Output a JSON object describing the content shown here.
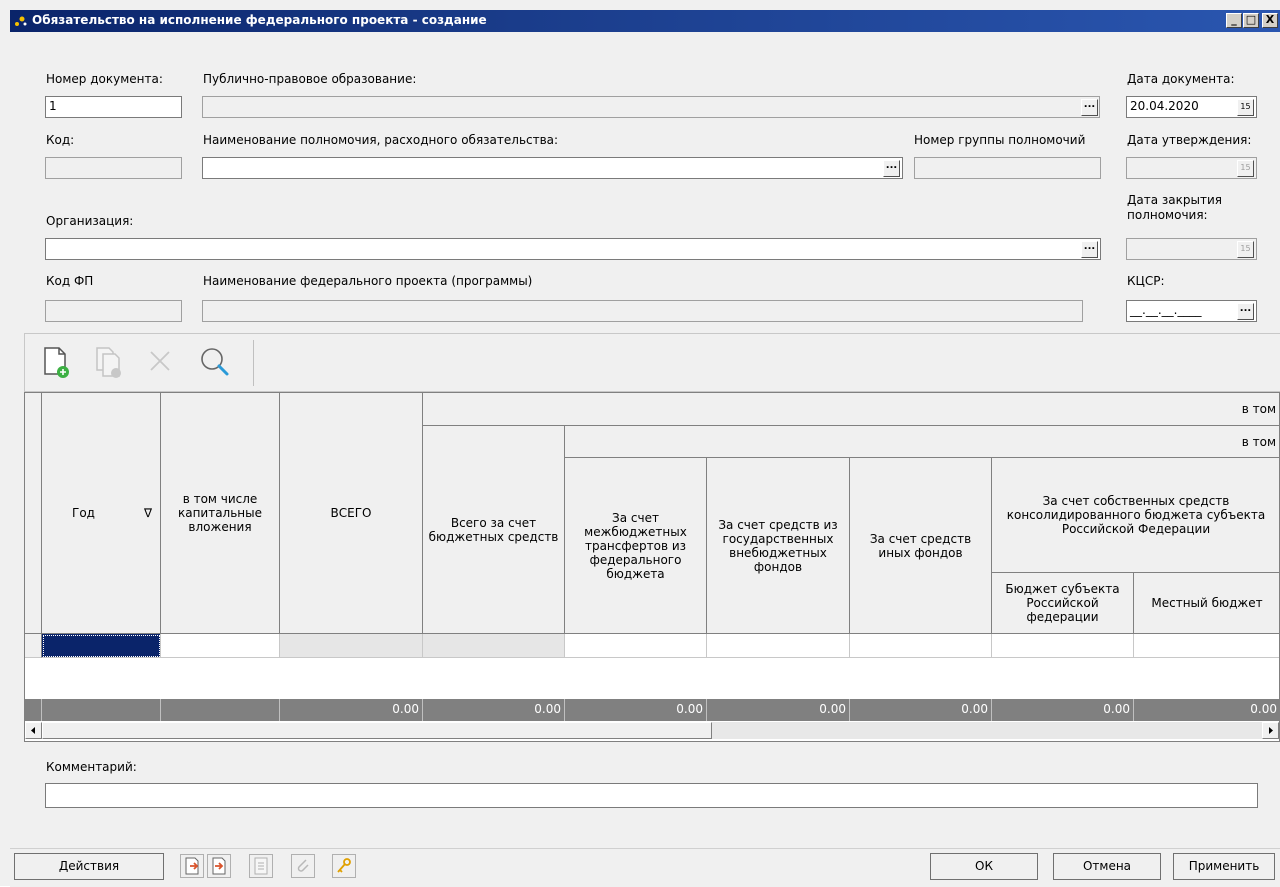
{
  "window": {
    "title": "Обязательство на исполнение федерального проекта - создание",
    "minimize_glyph": "_",
    "maximize_glyph": "□",
    "close_glyph": "X"
  },
  "form": {
    "doc_number_label": "Номер документа:",
    "doc_number_value": "1",
    "public_entity_label": "Публично-правовое образование:",
    "public_entity_value": "",
    "doc_date_label": "Дата документа:",
    "doc_date_value": "20.04.2020",
    "code_label": "Код:",
    "authority_name_label": "Наименование полномочия, расходного обязательства:",
    "authority_group_label": "Номер группы полномочий",
    "approval_date_label": "Дата утверждения:",
    "close_date_label_line1": "Дата закрытия",
    "close_date_label_line2": "полномочия:",
    "organization_label": "Организация:",
    "fp_code_label": "Код ФП",
    "fp_name_label": "Наименование федерального проекта (программы)",
    "kcsr_label": "КЦСР:",
    "kcsr_value": "__.__.__.____",
    "ellipsis": "...",
    "calendar_glyph": "15",
    "comment_label": "Комментарий:",
    "comment_value": ""
  },
  "toolbar": {
    "icons": [
      "new-document-icon",
      "copy-document-icon",
      "delete-icon",
      "search-icon"
    ]
  },
  "grid": {
    "group_header_1": "в том",
    "group_header_2": "в том",
    "columns": {
      "year": "Год",
      "capital": "в том числе капитальные вложения",
      "total": "ВСЕГО",
      "budget_total": "Всего за счет бюджетных средств",
      "federal_transfers": "За счет межбюджетных трансфертов из федерального бюджета",
      "state_funds": "За счет средств из государственных внебюджетных фондов",
      "other_funds": "За счет средств иных фондов",
      "own_funds": "За счет собственных средств консолидированного бюджета субъекта Российской Федерации",
      "subject_budget": "Бюджет субъекта Российской федерации",
      "local_budget": "Местный бюджет"
    },
    "sort_glyph": "∇",
    "totals": [
      "0.00",
      "0.00",
      "0.00",
      "0.00",
      "0.00",
      "0.00",
      "0.00"
    ]
  },
  "buttons": {
    "actions": "Действия",
    "ok": "ОК",
    "cancel": "Отмена",
    "apply": "Применить"
  },
  "colors": {
    "title_bar": "#0a246a",
    "selected_cell": "#0a246a",
    "totals_row": "#808080"
  }
}
